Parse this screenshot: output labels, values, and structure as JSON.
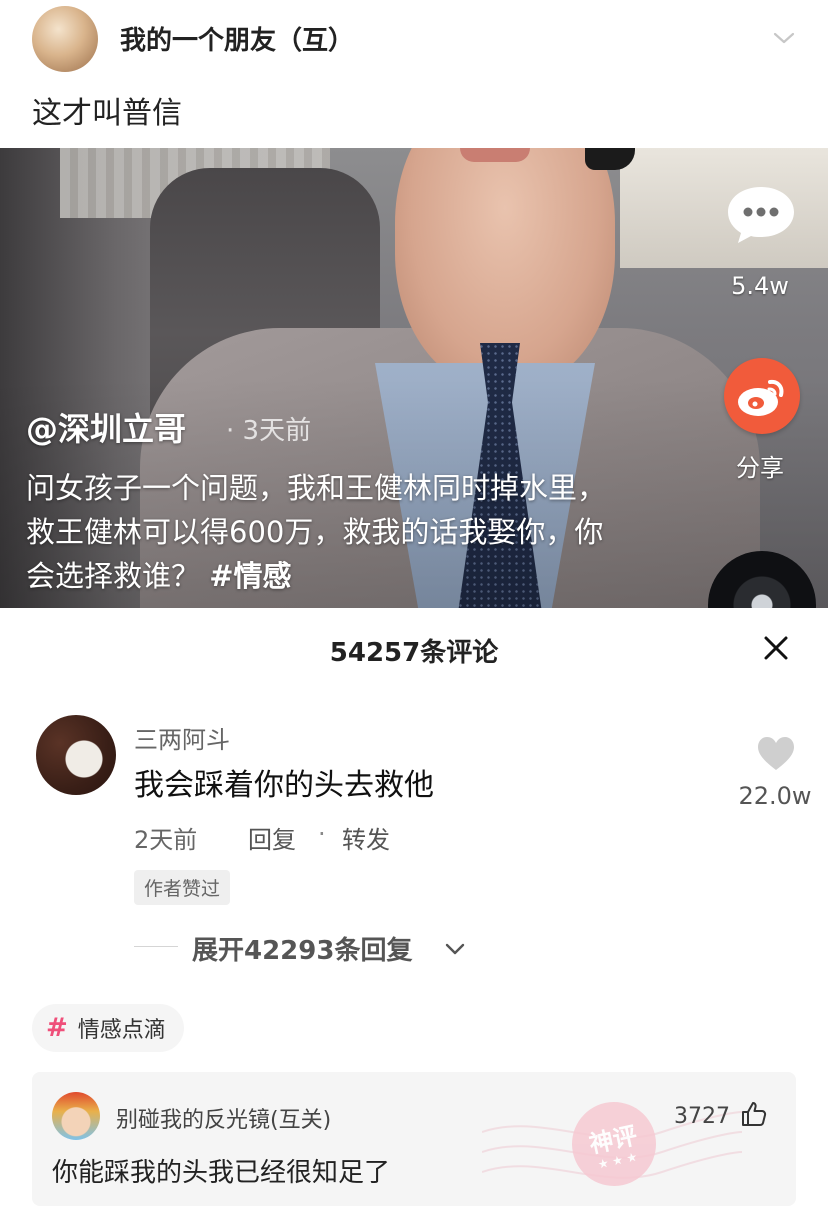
{
  "post": {
    "author_name": "我的一个朋友（互）",
    "text": "这才叫普信"
  },
  "video": {
    "handle": "@深圳立哥",
    "time": "· 3天前",
    "caption": "问女孩子一个问题，我和王健林同时掉水里，救王健林可以得600万，救我的话我娶你，你会选择救谁？",
    "hashtag": "#情感",
    "comment_count": "5.4w",
    "share_label": "分享"
  },
  "comments_sheet": {
    "title": "54257条评论",
    "comment": {
      "user": "三两阿斗",
      "text": "我会踩着你的头去救他",
      "time": "2天前",
      "reply": "回复",
      "separator": "·",
      "forward": "转发",
      "badge": "作者赞过",
      "likes": "22.0w",
      "expand": "展开42293条回复"
    }
  },
  "topic": {
    "label": "情感点滴",
    "icon": "#"
  },
  "god_comment": {
    "user": "别碰我的反光镜(互关)",
    "text": "你能踩我的头我已经很知足了",
    "likes": "3727",
    "stamp": "神评",
    "stamp_stars": "★ ★ ★"
  },
  "colors": {
    "weibo_red": "#f15b3b",
    "topic_pink": "#ef4f7a",
    "stamp_pink": "#f6c9d2"
  }
}
